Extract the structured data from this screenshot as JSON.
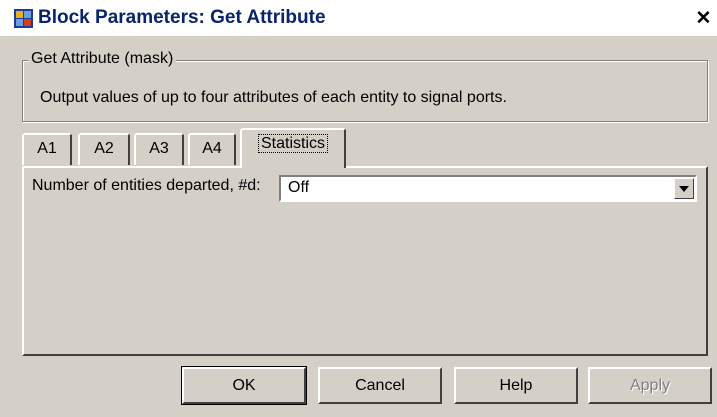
{
  "window": {
    "title": "Block Parameters: Get Attribute",
    "close_label": "✕"
  },
  "group": {
    "legend": "Get Attribute (mask)",
    "description": "Output values of up to four attributes of each entity to signal ports."
  },
  "tabs": [
    {
      "label": "A1",
      "active": false
    },
    {
      "label": "A2",
      "active": false
    },
    {
      "label": "A3",
      "active": false
    },
    {
      "label": "A4",
      "active": false
    },
    {
      "label": "Statistics",
      "active": true
    }
  ],
  "statistics": {
    "departed_label": "Number of entities departed, #d:",
    "departed_value": "Off"
  },
  "buttons": {
    "ok": "OK",
    "cancel": "Cancel",
    "help": "Help",
    "apply": "Apply"
  },
  "colors": {
    "dialog_bg": "#d4d0c8",
    "title_text": "#0a246a",
    "disabled_text": "#808080"
  },
  "icons": {
    "app": "simulink-block-icon",
    "close": "close-icon",
    "dropdown": "chevron-down-icon"
  }
}
